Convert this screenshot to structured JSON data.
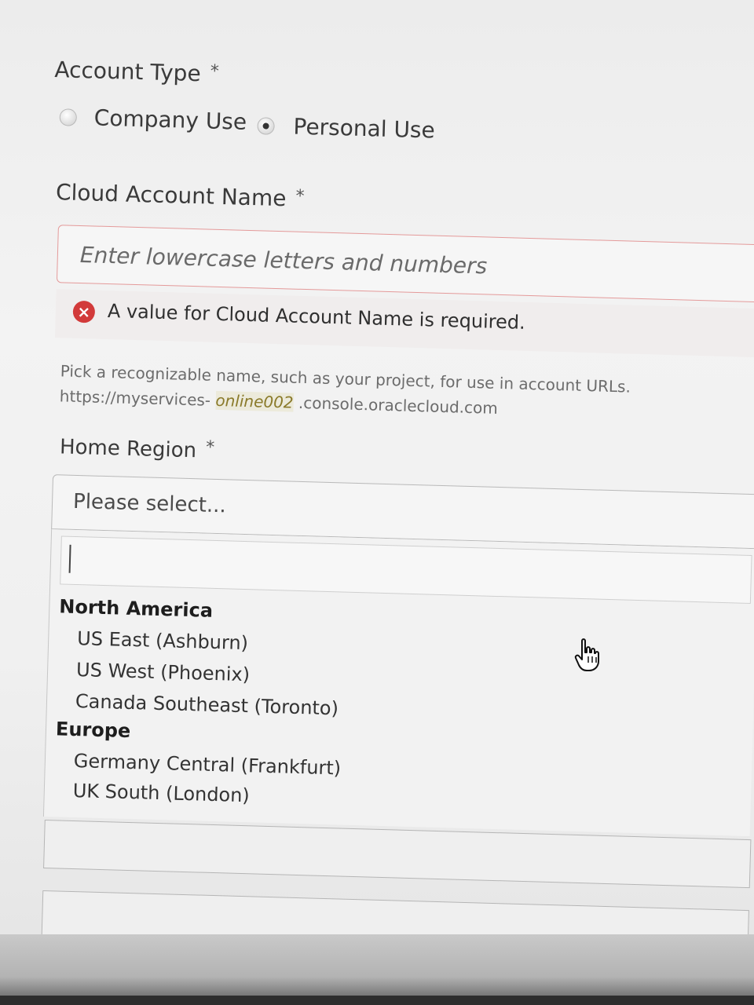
{
  "account_type": {
    "label": "Account Type",
    "required_mark": "*",
    "options": [
      {
        "label": "Company Use",
        "checked": false
      },
      {
        "label": "Personal Use",
        "checked": true
      }
    ]
  },
  "cloud_account_name": {
    "label": "Cloud Account Name",
    "required_mark": "*",
    "placeholder": "Enter lowercase letters and numbers",
    "value": "",
    "error": "A value for Cloud Account Name is required.",
    "hint_line1": "Pick a recognizable name, such as your project, for use in account URLs.",
    "url_prefix": "https://myservices-",
    "url_example": "online002",
    "url_suffix": ".console.oraclecloud.com"
  },
  "home_region": {
    "label": "Home Region",
    "required_mark": "*",
    "placeholder": "Please select...",
    "search_value": "",
    "groups": [
      {
        "name": "North America",
        "options": [
          "US East (Ashburn)",
          "US West (Phoenix)",
          "Canada Southeast (Toronto)"
        ]
      },
      {
        "name": "Europe",
        "options": [
          "Germany Central (Frankfurt)",
          "UK South (London)"
        ]
      }
    ]
  },
  "icons": {
    "error": "error-x-icon",
    "pointer": "hand-pointer-icon"
  },
  "colors": {
    "error_red": "#d23a3a",
    "input_error_border": "#e49a9a"
  }
}
